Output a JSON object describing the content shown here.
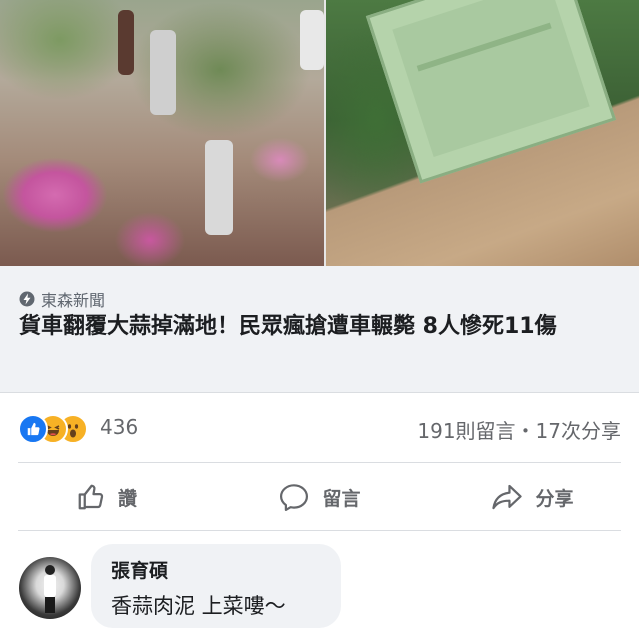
{
  "link_preview": {
    "source": "東森新聞",
    "headline": "貨車翻覆大蒜掉滿地！民眾瘋搶遭車輾斃 8人慘死11傷"
  },
  "reactions": {
    "icons": [
      "like-icon",
      "haha-icon",
      "wow-icon"
    ],
    "count": "436",
    "comments_shares": "191則留言・17次分享"
  },
  "actions": {
    "like": "讚",
    "comment": "留言",
    "share": "分享"
  },
  "comment": {
    "author": "張育碩",
    "text": "香蒜肉泥 上菜嘍～"
  },
  "colors": {
    "like_blue": "#1877f2",
    "haha_yellow": "#f7b125",
    "preview_bg": "#f0f2f5",
    "meta_gray": "#65676b"
  }
}
